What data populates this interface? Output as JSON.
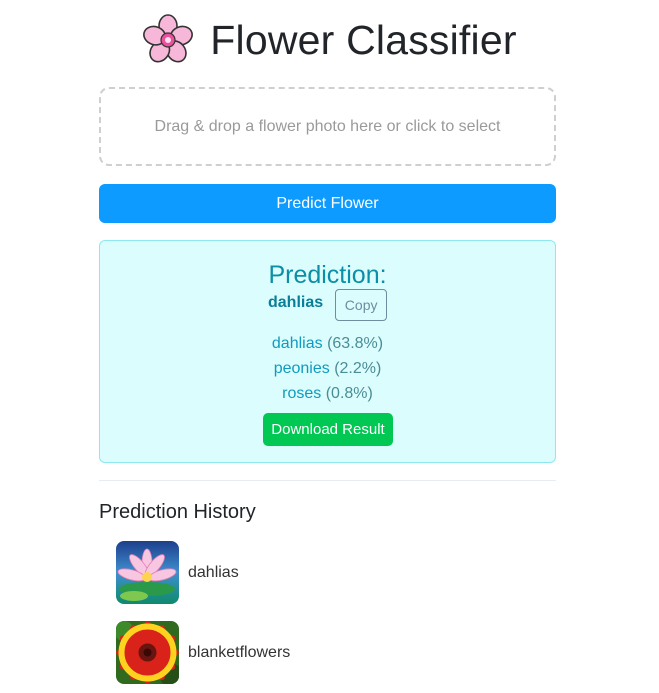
{
  "header": {
    "logo_icon": "cherry-blossom-icon",
    "title": "Flower Classifier"
  },
  "upload": {
    "prompt": "Drag & drop a flower photo here or click to select"
  },
  "actions": {
    "predict_label": "Predict Flower"
  },
  "result": {
    "heading": "Prediction:",
    "top_label": "dahlias",
    "copy_label": "Copy",
    "probabilities": [
      {
        "name": "dahlias",
        "percent": "(63.8%)"
      },
      {
        "name": "peonies",
        "percent": "(2.2%)"
      },
      {
        "name": "roses",
        "percent": "(0.8%)"
      }
    ],
    "download_label": "Download Result"
  },
  "history": {
    "heading": "Prediction History",
    "items": [
      {
        "label": "dahlias",
        "thumbnail": "water-lily-photo"
      },
      {
        "label": "blanketflowers",
        "thumbnail": "red-yellow-gaillardia-photo"
      }
    ]
  },
  "colors": {
    "primary": "#0d9bff",
    "success": "#00c853",
    "info_bg": "#dcfdfd",
    "info_border": "#8fe8f0",
    "info_text": "#0b8fa6"
  }
}
